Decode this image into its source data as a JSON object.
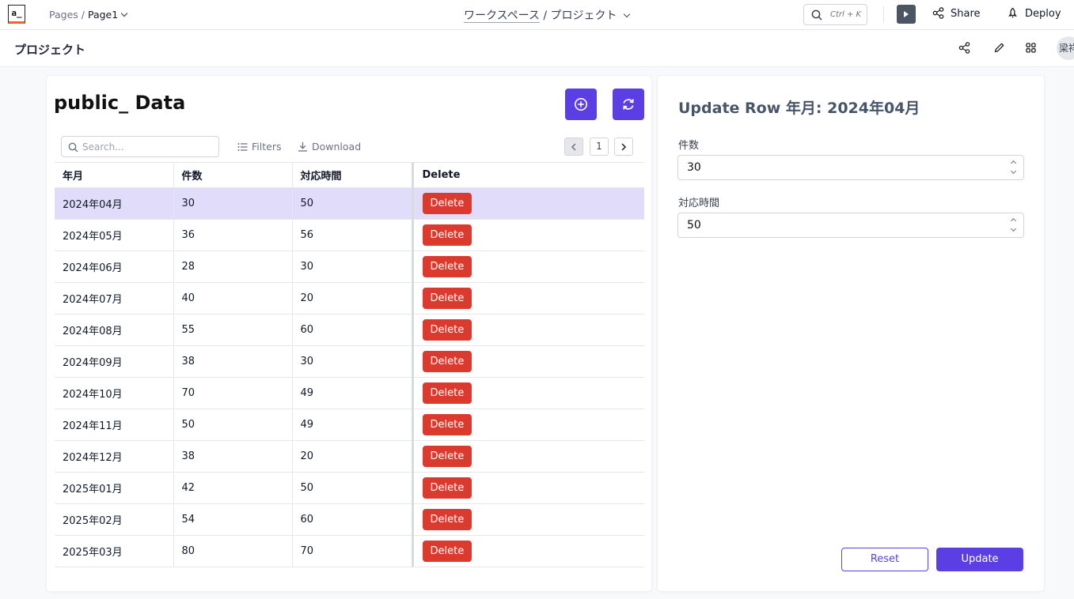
{
  "topbar": {
    "logo": "a_",
    "breadcrumb": {
      "pages": "Pages",
      "sep": "/",
      "page": "Page1"
    },
    "workspace": {
      "name": "ワークスペース",
      "sep": "/",
      "project": "プロジェクト"
    },
    "search_shortcut": "Ctrl + K",
    "share_label": "Share",
    "deploy_label": "Deploy"
  },
  "subbar": {
    "title": "プロジェクト",
    "avatar_text": "梁祥"
  },
  "table_panel": {
    "title": "public_ Data",
    "search_placeholder": "Search...",
    "filters_label": "Filters",
    "download_label": "Download",
    "page_number": "1",
    "columns": [
      "年月",
      "件数",
      "対応時間",
      "Delete"
    ],
    "rows": [
      {
        "month": "2024年04月",
        "count": "30",
        "time": "50",
        "delete_label": "Delete"
      },
      {
        "month": "2024年05月",
        "count": "36",
        "time": "56",
        "delete_label": "Delete"
      },
      {
        "month": "2024年06月",
        "count": "28",
        "time": "30",
        "delete_label": "Delete"
      },
      {
        "month": "2024年07月",
        "count": "40",
        "time": "20",
        "delete_label": "Delete"
      },
      {
        "month": "2024年08月",
        "count": "55",
        "time": "60",
        "delete_label": "Delete"
      },
      {
        "month": "2024年09月",
        "count": "38",
        "time": "30",
        "delete_label": "Delete"
      },
      {
        "month": "2024年10月",
        "count": "70",
        "time": "49",
        "delete_label": "Delete"
      },
      {
        "month": "2024年11月",
        "count": "50",
        "time": "49",
        "delete_label": "Delete"
      },
      {
        "month": "2024年12月",
        "count": "38",
        "time": "20",
        "delete_label": "Delete"
      },
      {
        "month": "2025年01月",
        "count": "42",
        "time": "50",
        "delete_label": "Delete"
      },
      {
        "month": "2025年02月",
        "count": "54",
        "time": "60",
        "delete_label": "Delete"
      },
      {
        "month": "2025年03月",
        "count": "80",
        "time": "70",
        "delete_label": "Delete"
      }
    ],
    "selected_row": 0
  },
  "form": {
    "title": "Update Row 年月: 2024年04月",
    "count_label": "件数",
    "count_value": "30",
    "time_label": "対応時間",
    "time_value": "50",
    "reset_label": "Reset",
    "update_label": "Update"
  },
  "colors": {
    "primary": "#5b3fe4",
    "danger": "#db3a2f",
    "selected_row": "#e0dcfa"
  }
}
